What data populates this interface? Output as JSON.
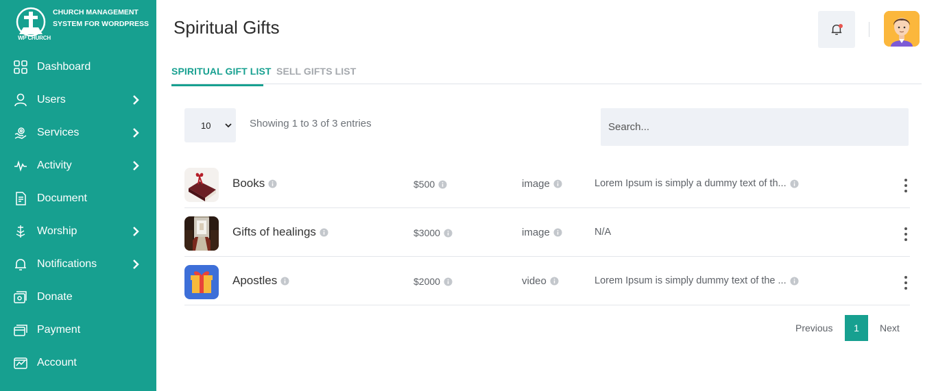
{
  "brand": {
    "logo_text": "WP CHURCH",
    "title": "CHURCH MANAGEMENT SYSTEM FOR WORDPRESS"
  },
  "sidebar": {
    "items": [
      {
        "label": "Dashboard",
        "icon": "dashboard-grid-icon",
        "has_submenu": false
      },
      {
        "label": "Users",
        "icon": "user-icon",
        "has_submenu": true
      },
      {
        "label": "Services",
        "icon": "hand-gear-icon",
        "has_submenu": true
      },
      {
        "label": "Activity",
        "icon": "activity-pulse-icon",
        "has_submenu": true
      },
      {
        "label": "Document",
        "icon": "document-icon",
        "has_submenu": false
      },
      {
        "label": "Worship",
        "icon": "worship-icon",
        "has_submenu": true
      },
      {
        "label": "Notifications",
        "icon": "bell-icon",
        "has_submenu": true
      },
      {
        "label": "Donate",
        "icon": "donate-icon",
        "has_submenu": false
      },
      {
        "label": "Payment",
        "icon": "payment-card-icon",
        "has_submenu": false
      },
      {
        "label": "Account",
        "icon": "account-icon",
        "has_submenu": false
      }
    ]
  },
  "header": {
    "title": "Spiritual Gifts",
    "notification_icon": "bell-icon",
    "avatar_icon": "user-avatar-icon"
  },
  "tabs": [
    {
      "label": "SPIRITUAL GIFT LIST",
      "active": true
    },
    {
      "label": "SELL GIFTS LIST",
      "active": false
    }
  ],
  "table_controls": {
    "page_length": "10",
    "entries_info": "Showing 1 to 3 of 3 entries",
    "search_placeholder": "Search..."
  },
  "gifts": [
    {
      "name": "Books",
      "price": "$500",
      "media_type": "image",
      "description": "Lorem Ipsum is simply a dummy text of th...",
      "thumbnail": "book-gift-thumbnail"
    },
    {
      "name": "Gifts of healings",
      "price": "$3000",
      "media_type": "image",
      "description": "N/A",
      "thumbnail": "church-interior-thumbnail"
    },
    {
      "name": "Apostles",
      "price": "$2000",
      "media_type": "video",
      "description": "Lorem Ipsum is simply dummy text of the ...",
      "thumbnail": "gift-box-thumbnail"
    }
  ],
  "pagination": {
    "previous": "Previous",
    "current": "1",
    "next": "Next"
  },
  "colors": {
    "primary": "#17a090",
    "input_bg": "#eef1f6",
    "notification_dot": "#e8544e",
    "avatar_bg": "#fbb73c"
  }
}
